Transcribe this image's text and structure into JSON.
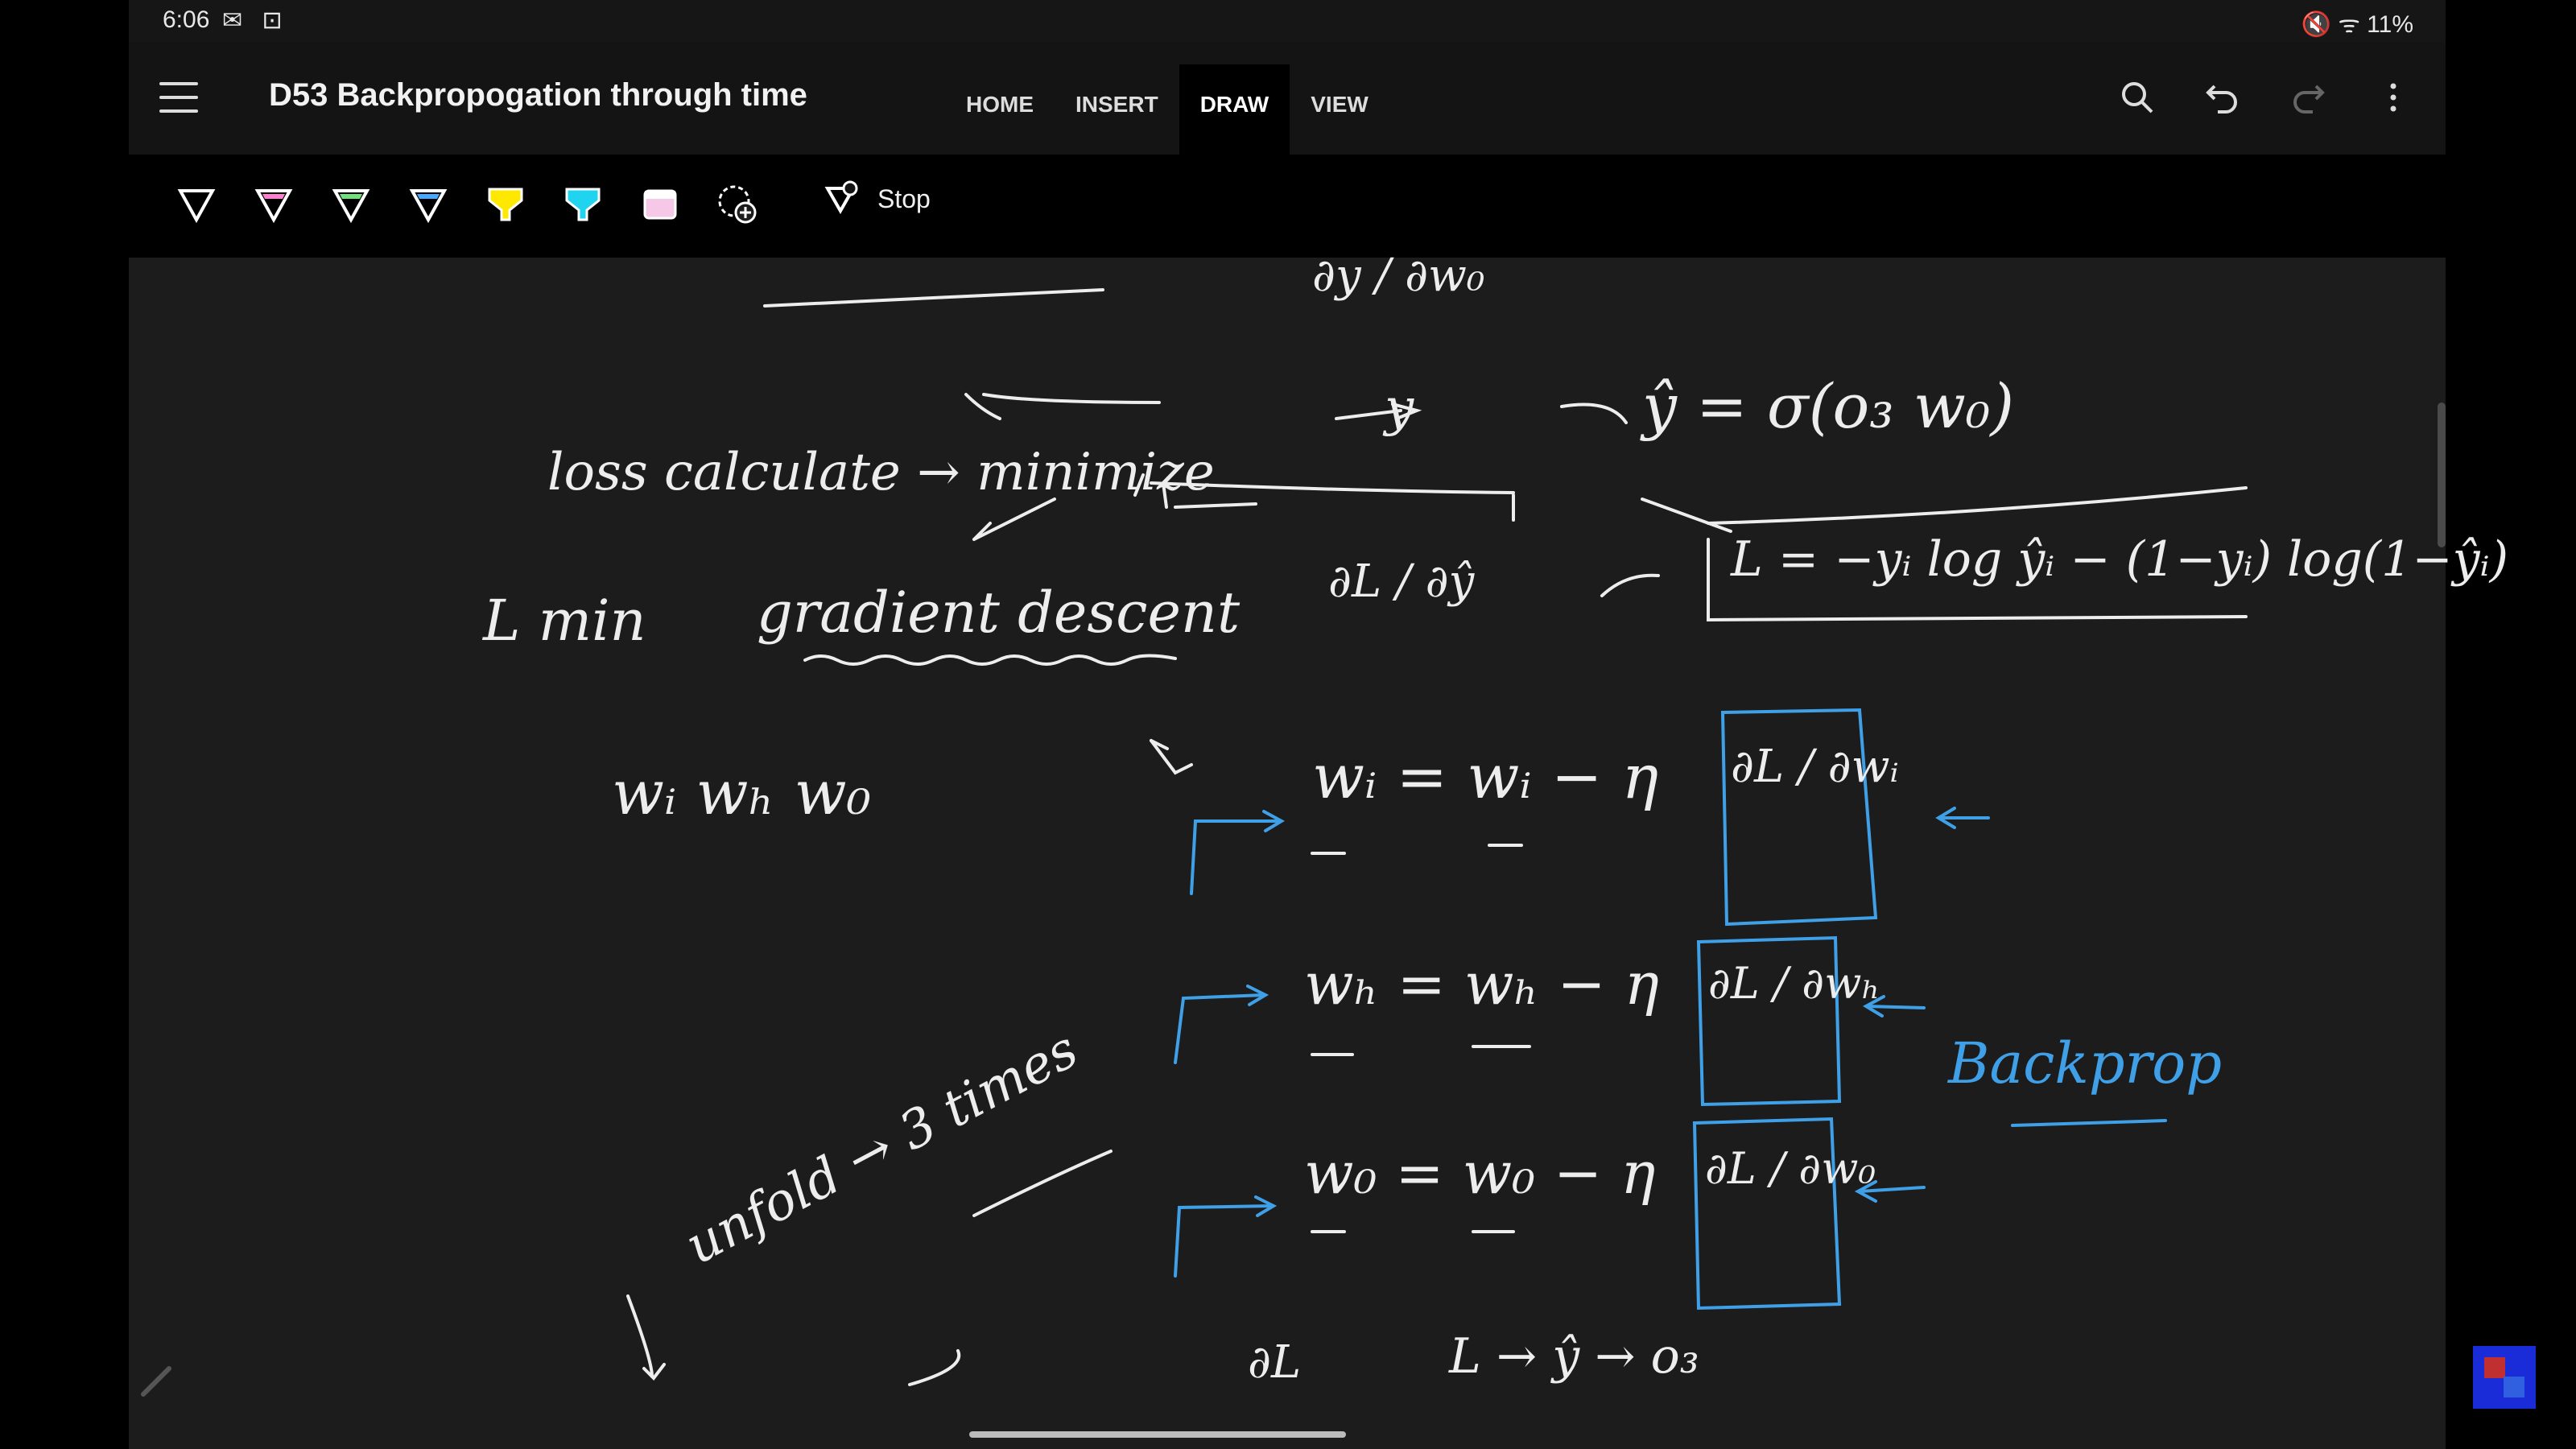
{
  "status": {
    "time": "6:06",
    "right": "11%"
  },
  "header": {
    "title": "D53 Backpropogation through time"
  },
  "tabs": [
    "HOME",
    "INSERT",
    "DRAW",
    "VIEW"
  ],
  "toolbar": {
    "stop_label": "Stop"
  },
  "ink": {
    "loss_line": "loss calculate → minimize",
    "lmin": "L min",
    "gd": "gradient descent",
    "weights": "wᵢ   wₕ   w₀",
    "unfold": "unfold → 3 times",
    "dy_dwo": "∂y / ∂w₀",
    "y": "y",
    "yhat_eq": "ŷ = σ(o₃ w₀)",
    "loss_eq": "L = −yᵢ log ŷᵢ − (1−yᵢ) log(1−ŷᵢ)",
    "dl_dyhat": "∂L / ∂ŷ",
    "wi_upd": "wᵢ = wᵢ − η",
    "wh_upd": "wₕ = wₕ − η",
    "wo_upd": "w₀ = w₀ − η",
    "dl_dwi": "∂L / ∂wᵢ",
    "dl_dwh": "∂L / ∂wₕ",
    "dl_dwo": "∂L / ∂w₀",
    "backprop": "Backprop",
    "bottom": "L → ŷ → o₃",
    "bottom_dl": "∂L"
  }
}
